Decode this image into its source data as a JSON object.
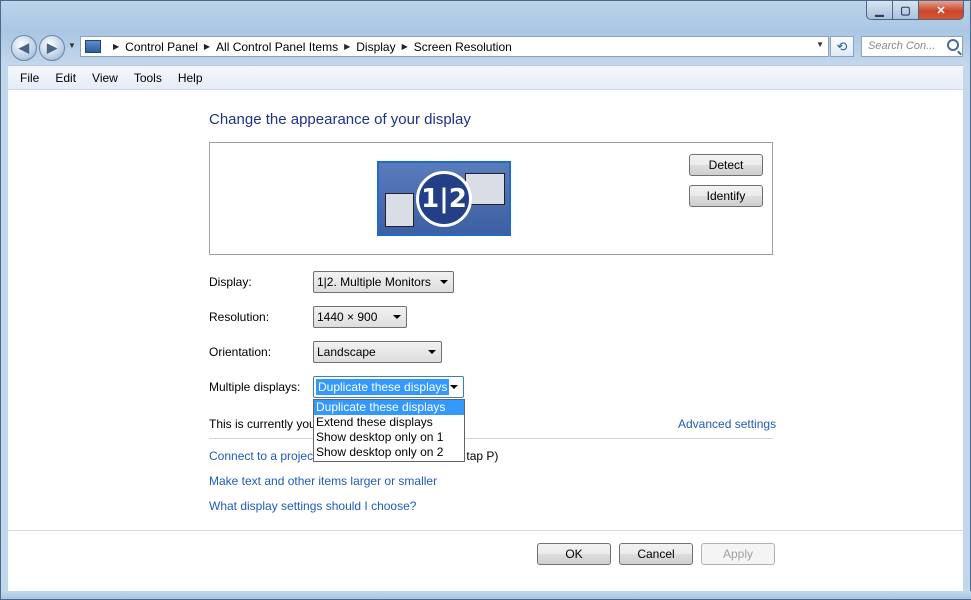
{
  "window": {
    "caption_buttons": {
      "minimize_icon": "minimize-icon",
      "maximize_icon": "maximize-icon",
      "close_icon": "close-icon"
    }
  },
  "navigation": {
    "back_icon": "back-arrow-icon",
    "forward_icon": "forward-arrow-icon",
    "breadcrumbs": [
      "Control Panel",
      "All Control Panel Items",
      "Display",
      "Screen Resolution"
    ],
    "search_placeholder": "Search Con..."
  },
  "menu": [
    "File",
    "Edit",
    "View",
    "Tools",
    "Help"
  ],
  "main": {
    "title": "Change the appearance of your display",
    "monitor_badge": "1|2",
    "detect_label": "Detect",
    "identify_label": "Identify",
    "fields": {
      "display_label": "Display:",
      "display_value": "1|2. Multiple Monitors",
      "resolution_label": "Resolution:",
      "resolution_value": "1440 × 900",
      "orientation_label": "Orientation:",
      "orientation_value": "Landscape",
      "multiple_label": "Multiple displays:",
      "multiple_value": "Duplicate these displays"
    },
    "dropdown_options": [
      "Duplicate these displays",
      "Extend these displays",
      "Show desktop only on 1",
      "Show desktop only on 2"
    ],
    "status_text": "This is currently you",
    "advanced_link": "Advanced settings",
    "links": {
      "projector_part1": "Connect to a projec",
      "projector_part2": "tap P)",
      "text_size": "Make text and other items larger or smaller",
      "help": "What display settings should I choose?"
    },
    "buttons": {
      "ok": "OK",
      "cancel": "Cancel",
      "apply": "Apply"
    }
  }
}
